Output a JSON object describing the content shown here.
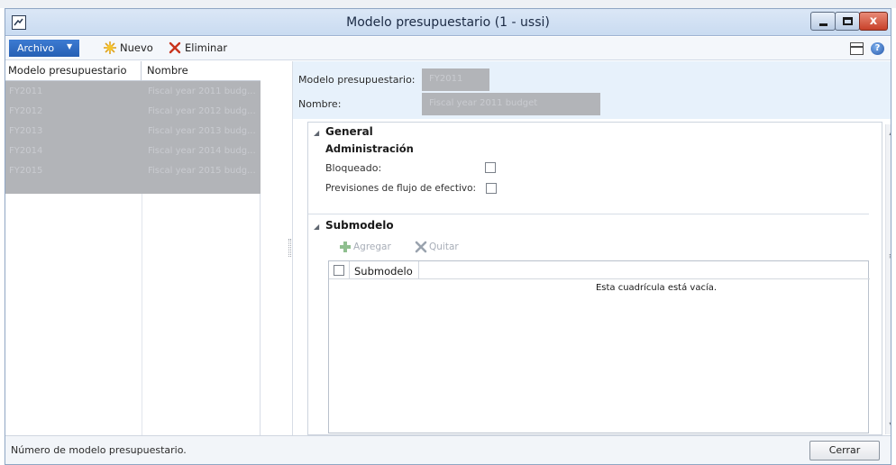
{
  "window": {
    "title": "Modelo presupuestario (1 - ussi)",
    "close_glyph": "x"
  },
  "toolbar": {
    "archivo_label": "Archivo",
    "nuevo_label": "Nuevo",
    "eliminar_label": "Eliminar"
  },
  "list": {
    "headers": [
      "Modelo presupuestario",
      "Nombre"
    ],
    "rows": [
      {
        "modelo": "FY2011",
        "nombre": "Fiscal year 2011 budg..."
      },
      {
        "modelo": "FY2012",
        "nombre": "Fiscal year 2012 budg..."
      },
      {
        "modelo": "FY2013",
        "nombre": "Fiscal year 2013 budg..."
      },
      {
        "modelo": "FY2014",
        "nombre": "Fiscal year 2014 budg..."
      },
      {
        "modelo": "FY2015",
        "nombre": "Fiscal year 2015 budg..."
      }
    ]
  },
  "header_fields": {
    "modelo_label": "Modelo presupuestario:",
    "modelo_value": "FY2011",
    "nombre_label": "Nombre:",
    "nombre_value": "Fiscal year 2011 budget"
  },
  "general": {
    "title": "General",
    "subtitle": "Administración",
    "bloqueado_label": "Bloqueado:",
    "previsiones_label": "Previsiones de flujo de efectivo:"
  },
  "submodelo": {
    "title": "Submodelo",
    "agregar_label": "Agregar",
    "quitar_label": "Quitar",
    "column": "Submodelo",
    "empty_text": "Esta cuadrícula está vacía."
  },
  "status": {
    "text": "Número de modelo presupuestario.",
    "cerrar_label": "Cerrar"
  },
  "colors": {
    "accent": "#2f6cc4",
    "close": "#c8412a",
    "redaction": "#b2b4b8"
  }
}
